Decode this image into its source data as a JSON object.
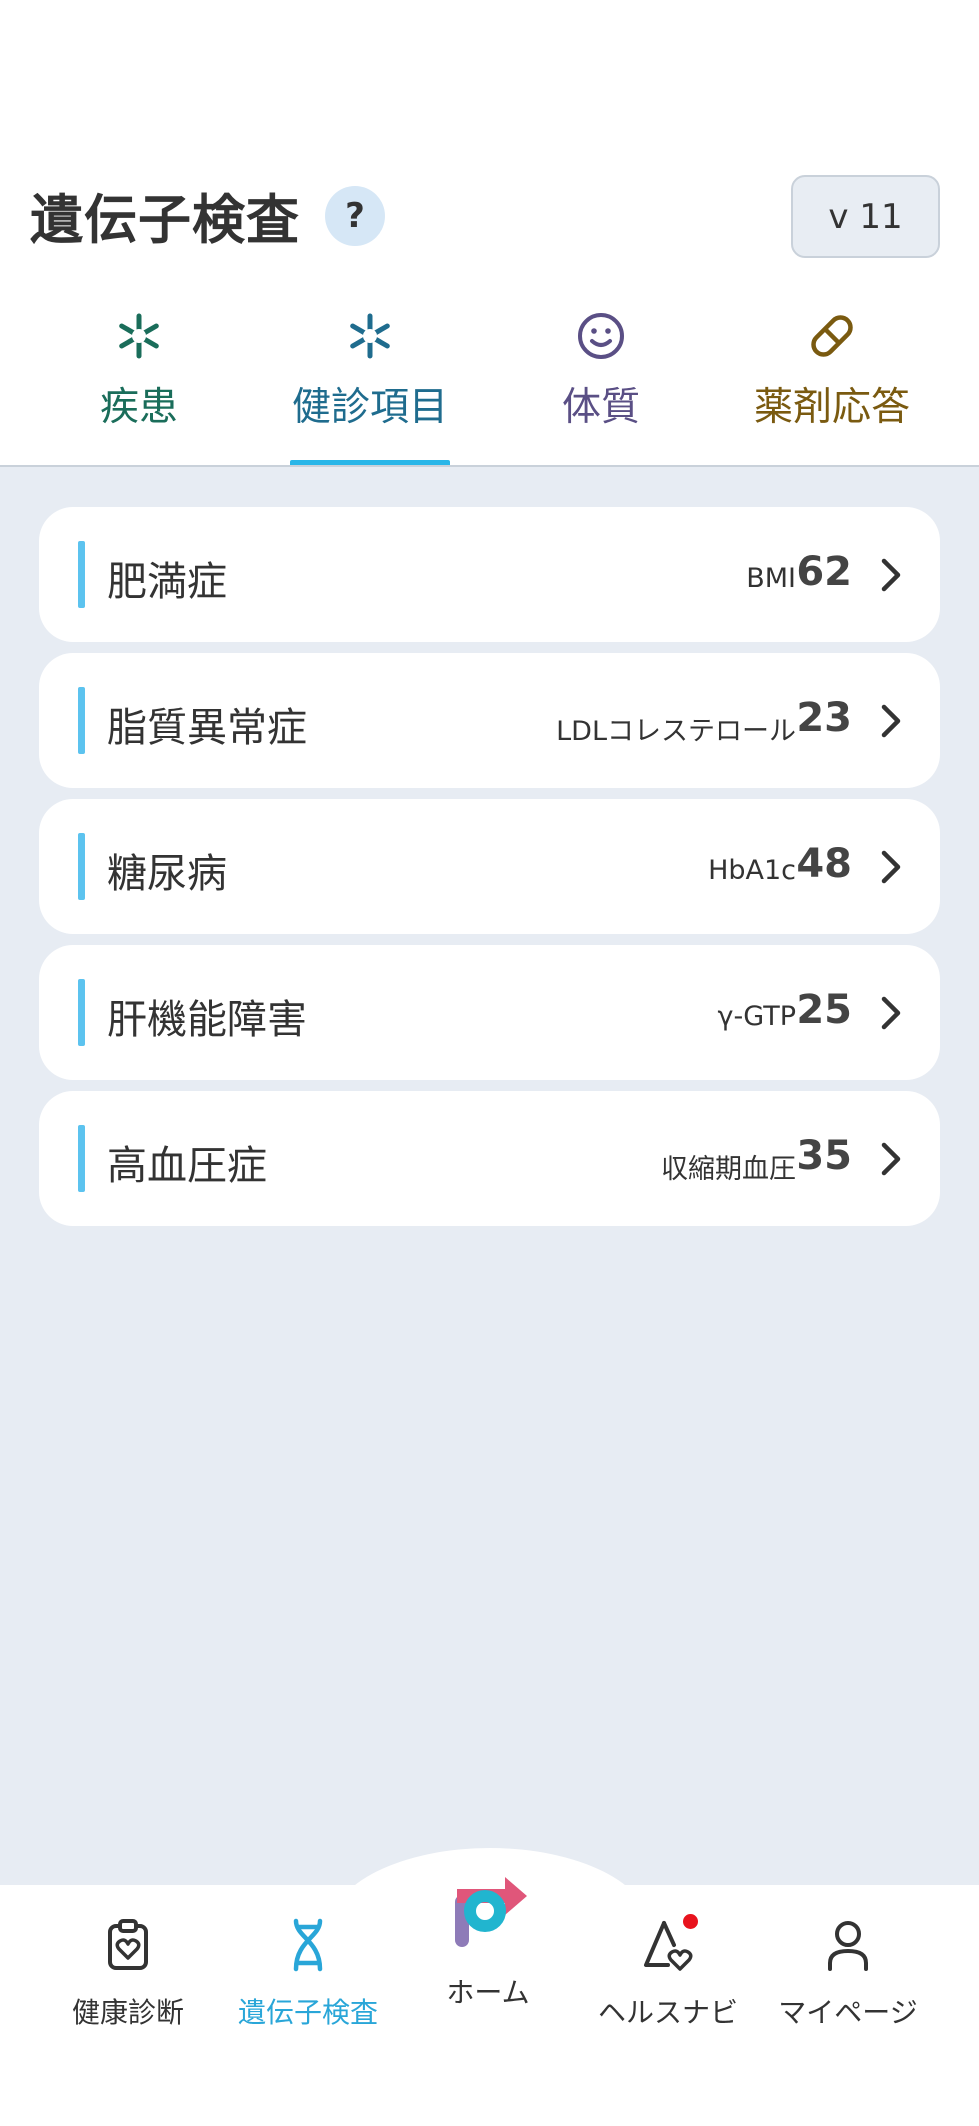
{
  "header": {
    "title": "遺伝子検査",
    "help_label": "?",
    "version_label": "v 11"
  },
  "tabs": [
    {
      "label": "疾患",
      "icon": "asterisk-icon",
      "color": "#1a6d5a"
    },
    {
      "label": "健診項目",
      "icon": "asterisk-icon",
      "color": "#1f6c8e",
      "active": true
    },
    {
      "label": "体質",
      "icon": "smile-icon",
      "color": "#5a4f85"
    },
    {
      "label": "薬剤応答",
      "icon": "pill-icon",
      "color": "#7a5a10"
    }
  ],
  "items": [
    {
      "name": "肥満症",
      "metric": "BMI",
      "value": "62"
    },
    {
      "name": "脂質異常症",
      "metric": "LDLコレステロール",
      "value": "23"
    },
    {
      "name": "糖尿病",
      "metric": "HbA1c",
      "value": "48"
    },
    {
      "name": "肝機能障害",
      "metric": "γ-GTP",
      "value": "25"
    },
    {
      "name": "高血圧症",
      "metric": "収縮期血圧",
      "value": "35"
    }
  ],
  "bottom_nav": [
    {
      "label": "健康診断",
      "icon": "clipboard-heart-icon"
    },
    {
      "label": "遺伝子検査",
      "icon": "dna-icon",
      "active": true
    },
    {
      "label": "ホーム",
      "icon": "home-logo-icon"
    },
    {
      "label": "ヘルスナビ",
      "icon": "navi-heart-icon",
      "notification": true
    },
    {
      "label": "マイページ",
      "icon": "user-icon"
    }
  ],
  "colors": {
    "accent": "#29b6e8",
    "background": "#e7ecf3",
    "card_accent": "#5cc3ef",
    "notification": "#e8131d"
  }
}
